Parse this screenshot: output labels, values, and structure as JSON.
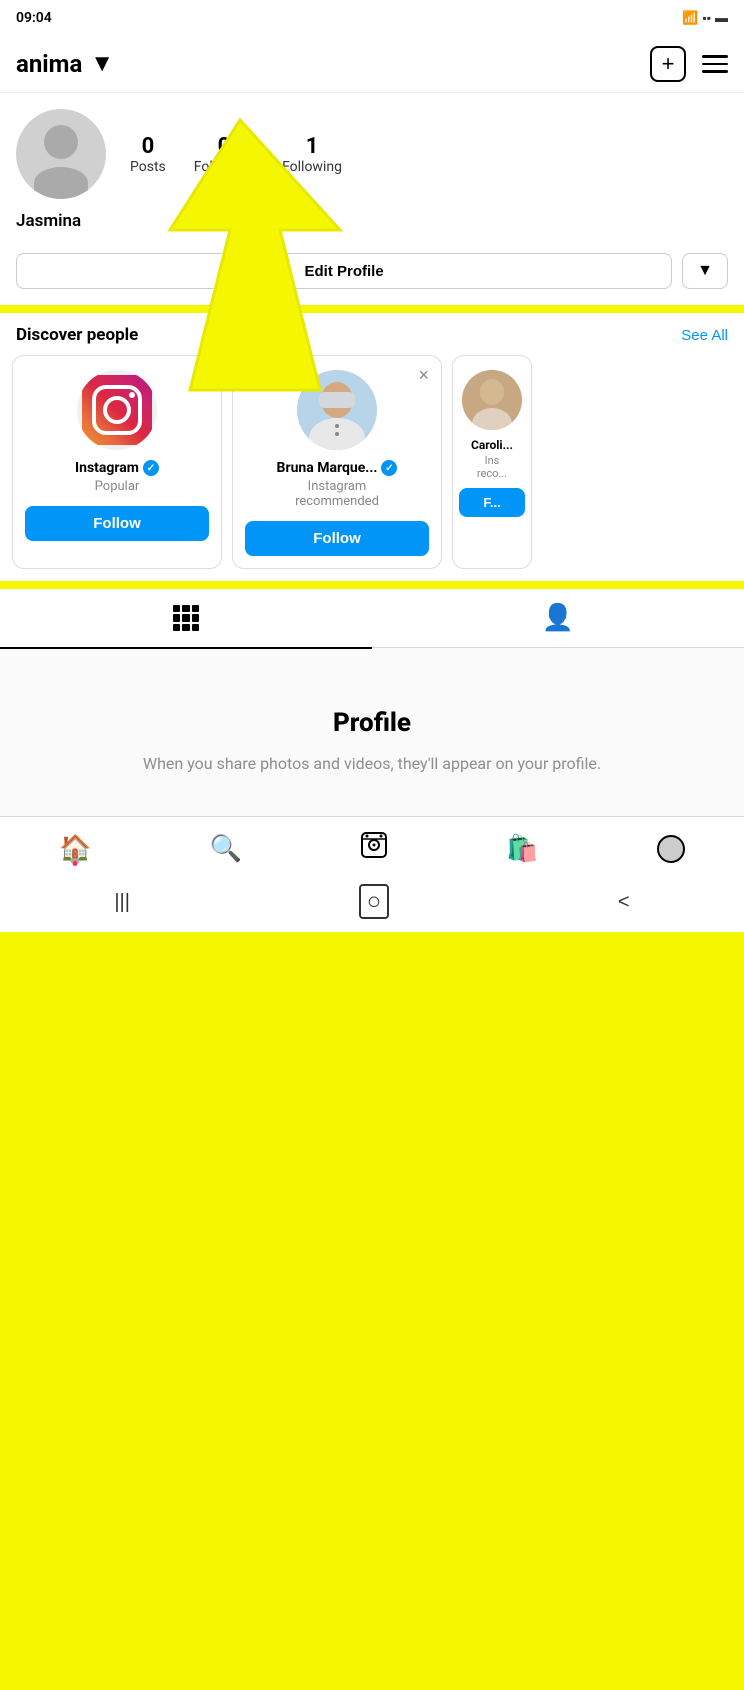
{
  "statusBar": {
    "time": "09:04",
    "icons": [
      "signal",
      "wifi",
      "battery"
    ]
  },
  "header": {
    "username": "anima",
    "chevron": "▼",
    "addButton": "+",
    "menuLabel": "menu"
  },
  "profile": {
    "posts": "0",
    "postsLabel": "Posts",
    "followers": "0",
    "followersLabel": "Followers",
    "following": "1",
    "followingLabel": "Following",
    "name": "Jasmina"
  },
  "editProfile": {
    "editButtonLabel": "Edit Profile",
    "dropdownLabel": "▼"
  },
  "discover": {
    "sectionTitle": "Discover people",
    "seeAllLabel": "See All",
    "cards": [
      {
        "name": "Instagram",
        "subtitle": "Popular",
        "verified": true,
        "followLabel": "Follow",
        "type": "logo"
      },
      {
        "name": "Bruna Marque...",
        "subtitle": "Instagram recommended",
        "verified": true,
        "followLabel": "Follow",
        "type": "person"
      },
      {
        "name": "Caroli...",
        "subtitle": "Ins recom...",
        "verified": false,
        "followLabel": "F...",
        "type": "person2"
      }
    ]
  },
  "tabs": [
    {
      "id": "grid",
      "label": "grid",
      "active": true
    },
    {
      "id": "tagged",
      "label": "tagged",
      "active": false
    }
  ],
  "emptyProfile": {
    "title": "Profile",
    "description": "When you share photos and videos, they'll appear on your profile."
  },
  "bottomNav": [
    {
      "id": "home",
      "label": "home",
      "icon": "home",
      "hasNotification": true
    },
    {
      "id": "search",
      "label": "search",
      "icon": "search",
      "hasNotification": false
    },
    {
      "id": "reels",
      "label": "reels",
      "icon": "reels",
      "hasNotification": false
    },
    {
      "id": "shop",
      "label": "shop",
      "icon": "shop",
      "hasNotification": false
    },
    {
      "id": "profile",
      "label": "profile",
      "icon": "profile",
      "hasNotification": false
    }
  ],
  "androidNav": {
    "back": "<",
    "home": "○",
    "recent": "|||"
  }
}
